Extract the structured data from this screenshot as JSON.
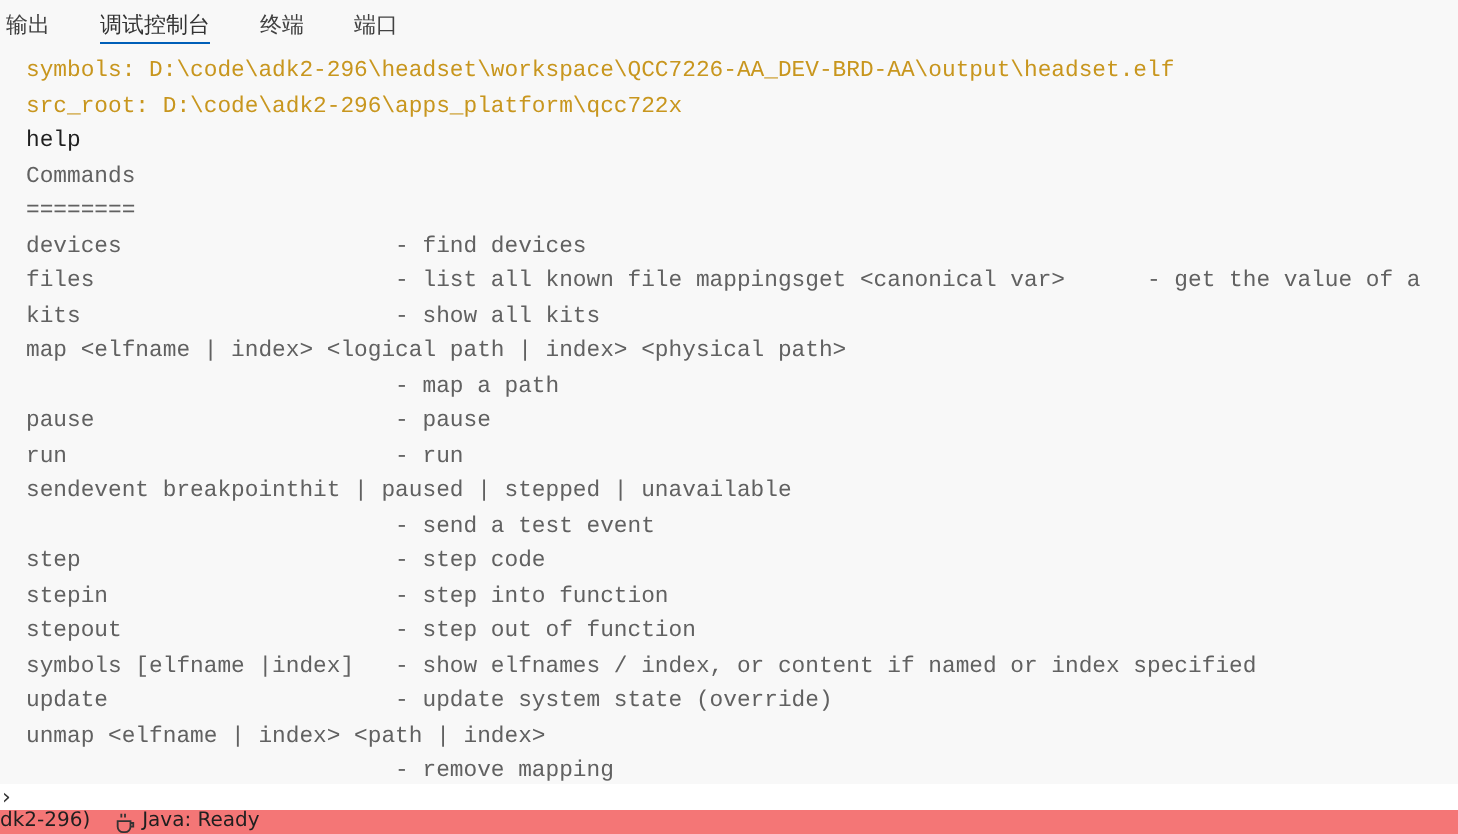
{
  "tabs": [
    {
      "label": "输出",
      "selected": false
    },
    {
      "label": "调试控制台",
      "selected": true
    },
    {
      "label": "终端",
      "selected": false
    },
    {
      "label": "端口",
      "selected": false
    }
  ],
  "console": {
    "lines": [
      {
        "kind": "info",
        "text": "symbols: D:\\code\\adk2-296\\headset\\workspace\\QCC7226-AA_DEV-BRD-AA\\output\\headset.elf"
      },
      {
        "kind": "info",
        "text": "src_root: D:\\code\\adk2-296\\apps_platform\\qcc722x"
      },
      {
        "kind": "input",
        "text": "help"
      },
      {
        "kind": "output",
        "text": "Commands"
      },
      {
        "kind": "output",
        "text": "========"
      },
      {
        "kind": "output",
        "text": "devices                    - find devices"
      },
      {
        "kind": "output",
        "text": "files                      - list all known file mappingsget <canonical var>      - get the value of a"
      },
      {
        "kind": "output",
        "text": "kits                       - show all kits"
      },
      {
        "kind": "output",
        "text": "map <elfname | index> <logical path | index> <physical path>"
      },
      {
        "kind": "output",
        "text": "                           - map a path"
      },
      {
        "kind": "output",
        "text": "pause                      - pause"
      },
      {
        "kind": "output",
        "text": "run                        - run"
      },
      {
        "kind": "output",
        "text": "sendevent breakpointhit | paused | stepped | unavailable"
      },
      {
        "kind": "output",
        "text": "                           - send a test event"
      },
      {
        "kind": "output",
        "text": "step                       - step code"
      },
      {
        "kind": "output",
        "text": "stepin                     - step into function"
      },
      {
        "kind": "output",
        "text": "stepout                    - step out of function"
      },
      {
        "kind": "output",
        "text": "symbols [elfname |index]   - show elfnames / index, or content if named or index specified"
      },
      {
        "kind": "output",
        "text": "update                     - update system state (override)"
      },
      {
        "kind": "output",
        "text": "unmap <elfname | index> <path | index>"
      },
      {
        "kind": "output",
        "text": "                           - remove mapping"
      }
    ],
    "prompt": "›"
  },
  "status_bar": {
    "items": [
      "dk2-296)",
      "Java: Ready"
    ]
  }
}
